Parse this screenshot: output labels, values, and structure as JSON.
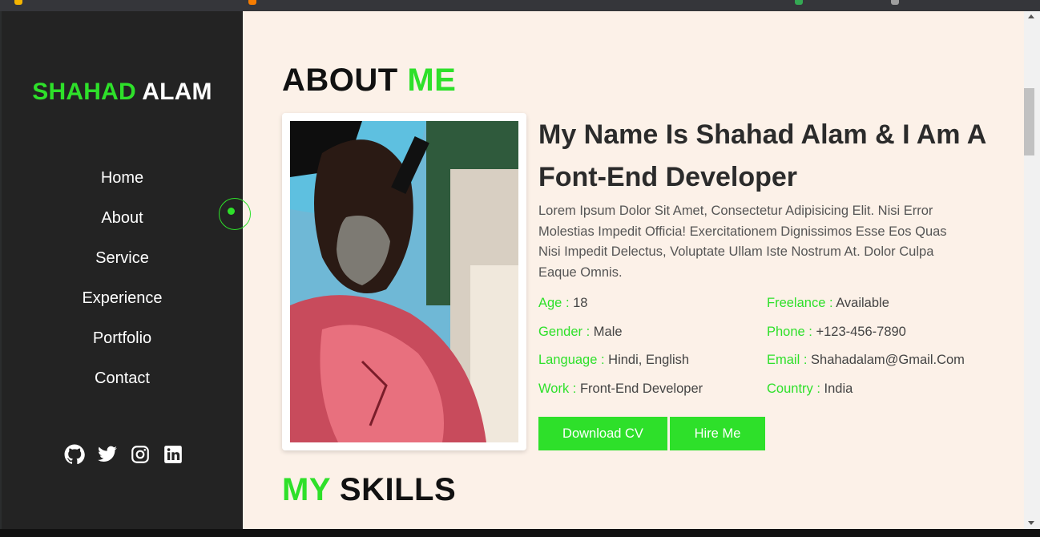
{
  "sidebar": {
    "logo_first": "SHAHAD",
    "logo_second": " ALAM",
    "nav": [
      {
        "label": "Home"
      },
      {
        "label": "About"
      },
      {
        "label": "Service"
      },
      {
        "label": "Experience"
      },
      {
        "label": "Portfolio"
      },
      {
        "label": "Contact"
      }
    ],
    "socials": [
      "github-icon",
      "twitter-icon",
      "instagram-icon",
      "linkedin-icon"
    ]
  },
  "about": {
    "heading_main": "ABOUT ",
    "heading_accent": "ME",
    "title": "My Name Is Shahad Alam & I Am A Font-End Developer",
    "description": "Lorem Ipsum Dolor Sit Amet, Consectetur Adipisicing Elit. Nisi Error Molestias Impedit Officia! Exercitationem Dignissimos Esse Eos Quas Nisi Impedit Delectus, Voluptate Ullam Iste Nostrum At. Dolor Culpa Eaque Omnis.",
    "info": [
      {
        "key": "Age : ",
        "value": "18"
      },
      {
        "key": "Freelance : ",
        "value": "Available"
      },
      {
        "key": "Gender : ",
        "value": "Male"
      },
      {
        "key": "Phone : ",
        "value": "+123-456-7890"
      },
      {
        "key": "Language : ",
        "value": "Hindi, English"
      },
      {
        "key": "Email : ",
        "value": "Shahadalam@Gmail.Com"
      },
      {
        "key": "Work : ",
        "value": "Front-End Developer"
      },
      {
        "key": "Country : ",
        "value": "India"
      }
    ],
    "download_cv_label": "Download CV",
    "hire_me_label": "Hire Me"
  },
  "skills": {
    "heading_accent": "MY",
    "heading_main": " SKILLS"
  },
  "colors": {
    "accent": "#2ee02a",
    "sidebar_bg": "#232323",
    "main_bg": "#fcf1e8"
  }
}
